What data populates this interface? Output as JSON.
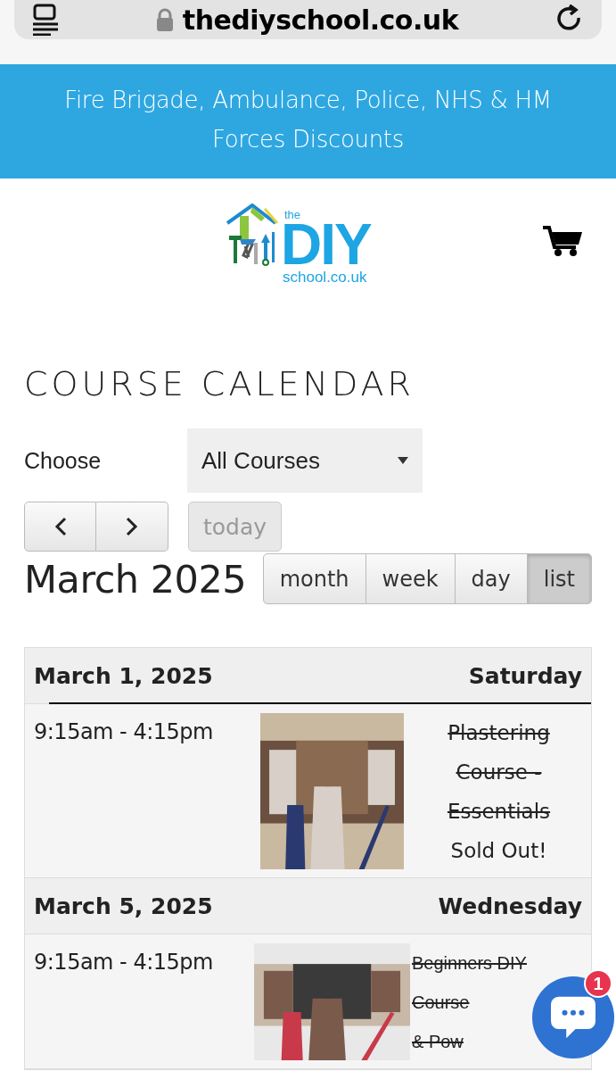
{
  "browser_bar": {
    "url": "thediyschool.co.uk"
  },
  "banner": {
    "text": "Fire Brigade, Ambulance, Police, NHS & HM Forces Discounts"
  },
  "logo": {
    "top": "the",
    "main": "DIY",
    "bottom": "school.co.uk"
  },
  "page_title": "COURSE CALENDAR",
  "filter": {
    "label": "Choose",
    "value": "All Courses"
  },
  "today_button": {
    "label": "today",
    "disabled": true
  },
  "month_title": "March 2025",
  "views": [
    {
      "label": "month",
      "selected": false
    },
    {
      "label": "week",
      "selected": false
    },
    {
      "label": "day",
      "selected": false
    },
    {
      "label": "list",
      "selected": true
    }
  ],
  "days": [
    {
      "date": "March 1, 2025",
      "weekday": "Saturday",
      "underlined": true,
      "events": [
        {
          "time": "9:15am - 4:15pm",
          "title_lines": [
            "Plastering",
            "Course -",
            "Essentials"
          ],
          "struck": true,
          "status": "Sold Out!"
        }
      ]
    },
    {
      "date": "March 5, 2025",
      "weekday": "Wednesday",
      "underlined": false,
      "events": [
        {
          "time": "9:15am - 4:15pm",
          "title_lines": [
            "Beginners DIY",
            "Course",
            "& Pow"
          ],
          "struck": true
        }
      ]
    }
  ],
  "chat": {
    "badge": "1"
  }
}
